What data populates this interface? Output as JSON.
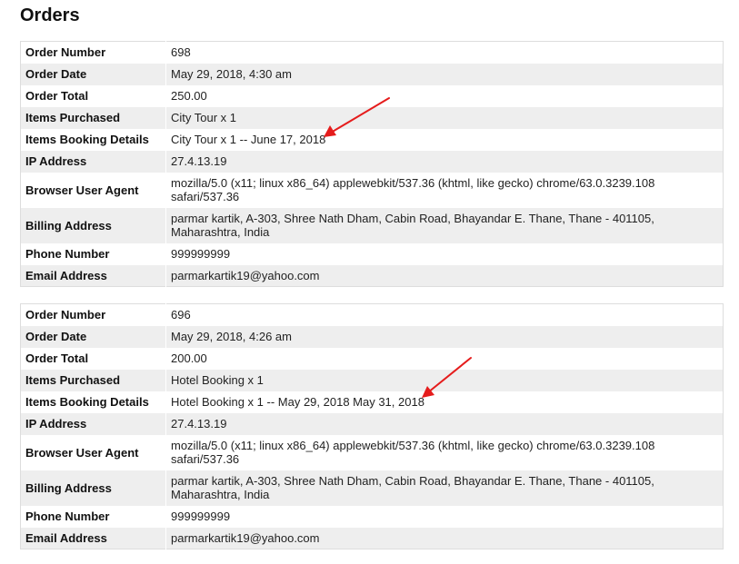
{
  "page": {
    "title": "Orders"
  },
  "colors": {
    "annotation_arrow": "#e51c1c",
    "row_stripe": "#eeeeee",
    "border": "#dddddd"
  },
  "orders": [
    {
      "rows": [
        {
          "label": "Order Number",
          "value": "698"
        },
        {
          "label": "Order Date",
          "value": "May 29, 2018, 4:30 am"
        },
        {
          "label": "Order Total",
          "value": "250.00"
        },
        {
          "label": "Items Purchased",
          "value": "City Tour x 1"
        },
        {
          "label": "Items Booking Details",
          "value": "City Tour x 1 -- June 17, 2018"
        },
        {
          "label": "IP Address",
          "value": "27.4.13.19"
        },
        {
          "label": "Browser User Agent",
          "value": "mozilla/5.0 (x11; linux x86_64) applewebkit/537.36 (khtml, like gecko) chrome/63.0.3239.108 safari/537.36"
        },
        {
          "label": "Billing Address",
          "value": "parmar kartik, A-303, Shree Nath Dham, Cabin Road, Bhayandar E. Thane, Thane - 401105, Maharashtra, India"
        },
        {
          "label": "Phone Number",
          "value": "999999999"
        },
        {
          "label": "Email Address",
          "value": "parmarkartik19@yahoo.com"
        }
      ]
    },
    {
      "rows": [
        {
          "label": "Order Number",
          "value": "696"
        },
        {
          "label": "Order Date",
          "value": "May 29, 2018, 4:26 am"
        },
        {
          "label": "Order Total",
          "value": "200.00"
        },
        {
          "label": "Items Purchased",
          "value": "Hotel Booking x 1"
        },
        {
          "label": "Items Booking Details",
          "value": "Hotel Booking x 1 -- May 29, 2018 May 31, 2018"
        },
        {
          "label": "IP Address",
          "value": "27.4.13.19"
        },
        {
          "label": "Browser User Agent",
          "value": "mozilla/5.0 (x11; linux x86_64) applewebkit/537.36 (khtml, like gecko) chrome/63.0.3239.108 safari/537.36"
        },
        {
          "label": "Billing Address",
          "value": "parmar kartik, A-303, Shree Nath Dham, Cabin Road, Bhayandar E. Thane, Thane - 401105, Maharashtra, India"
        },
        {
          "label": "Phone Number",
          "value": "999999999"
        },
        {
          "label": "Email Address",
          "value": "parmarkartik19@yahoo.com"
        }
      ]
    }
  ]
}
